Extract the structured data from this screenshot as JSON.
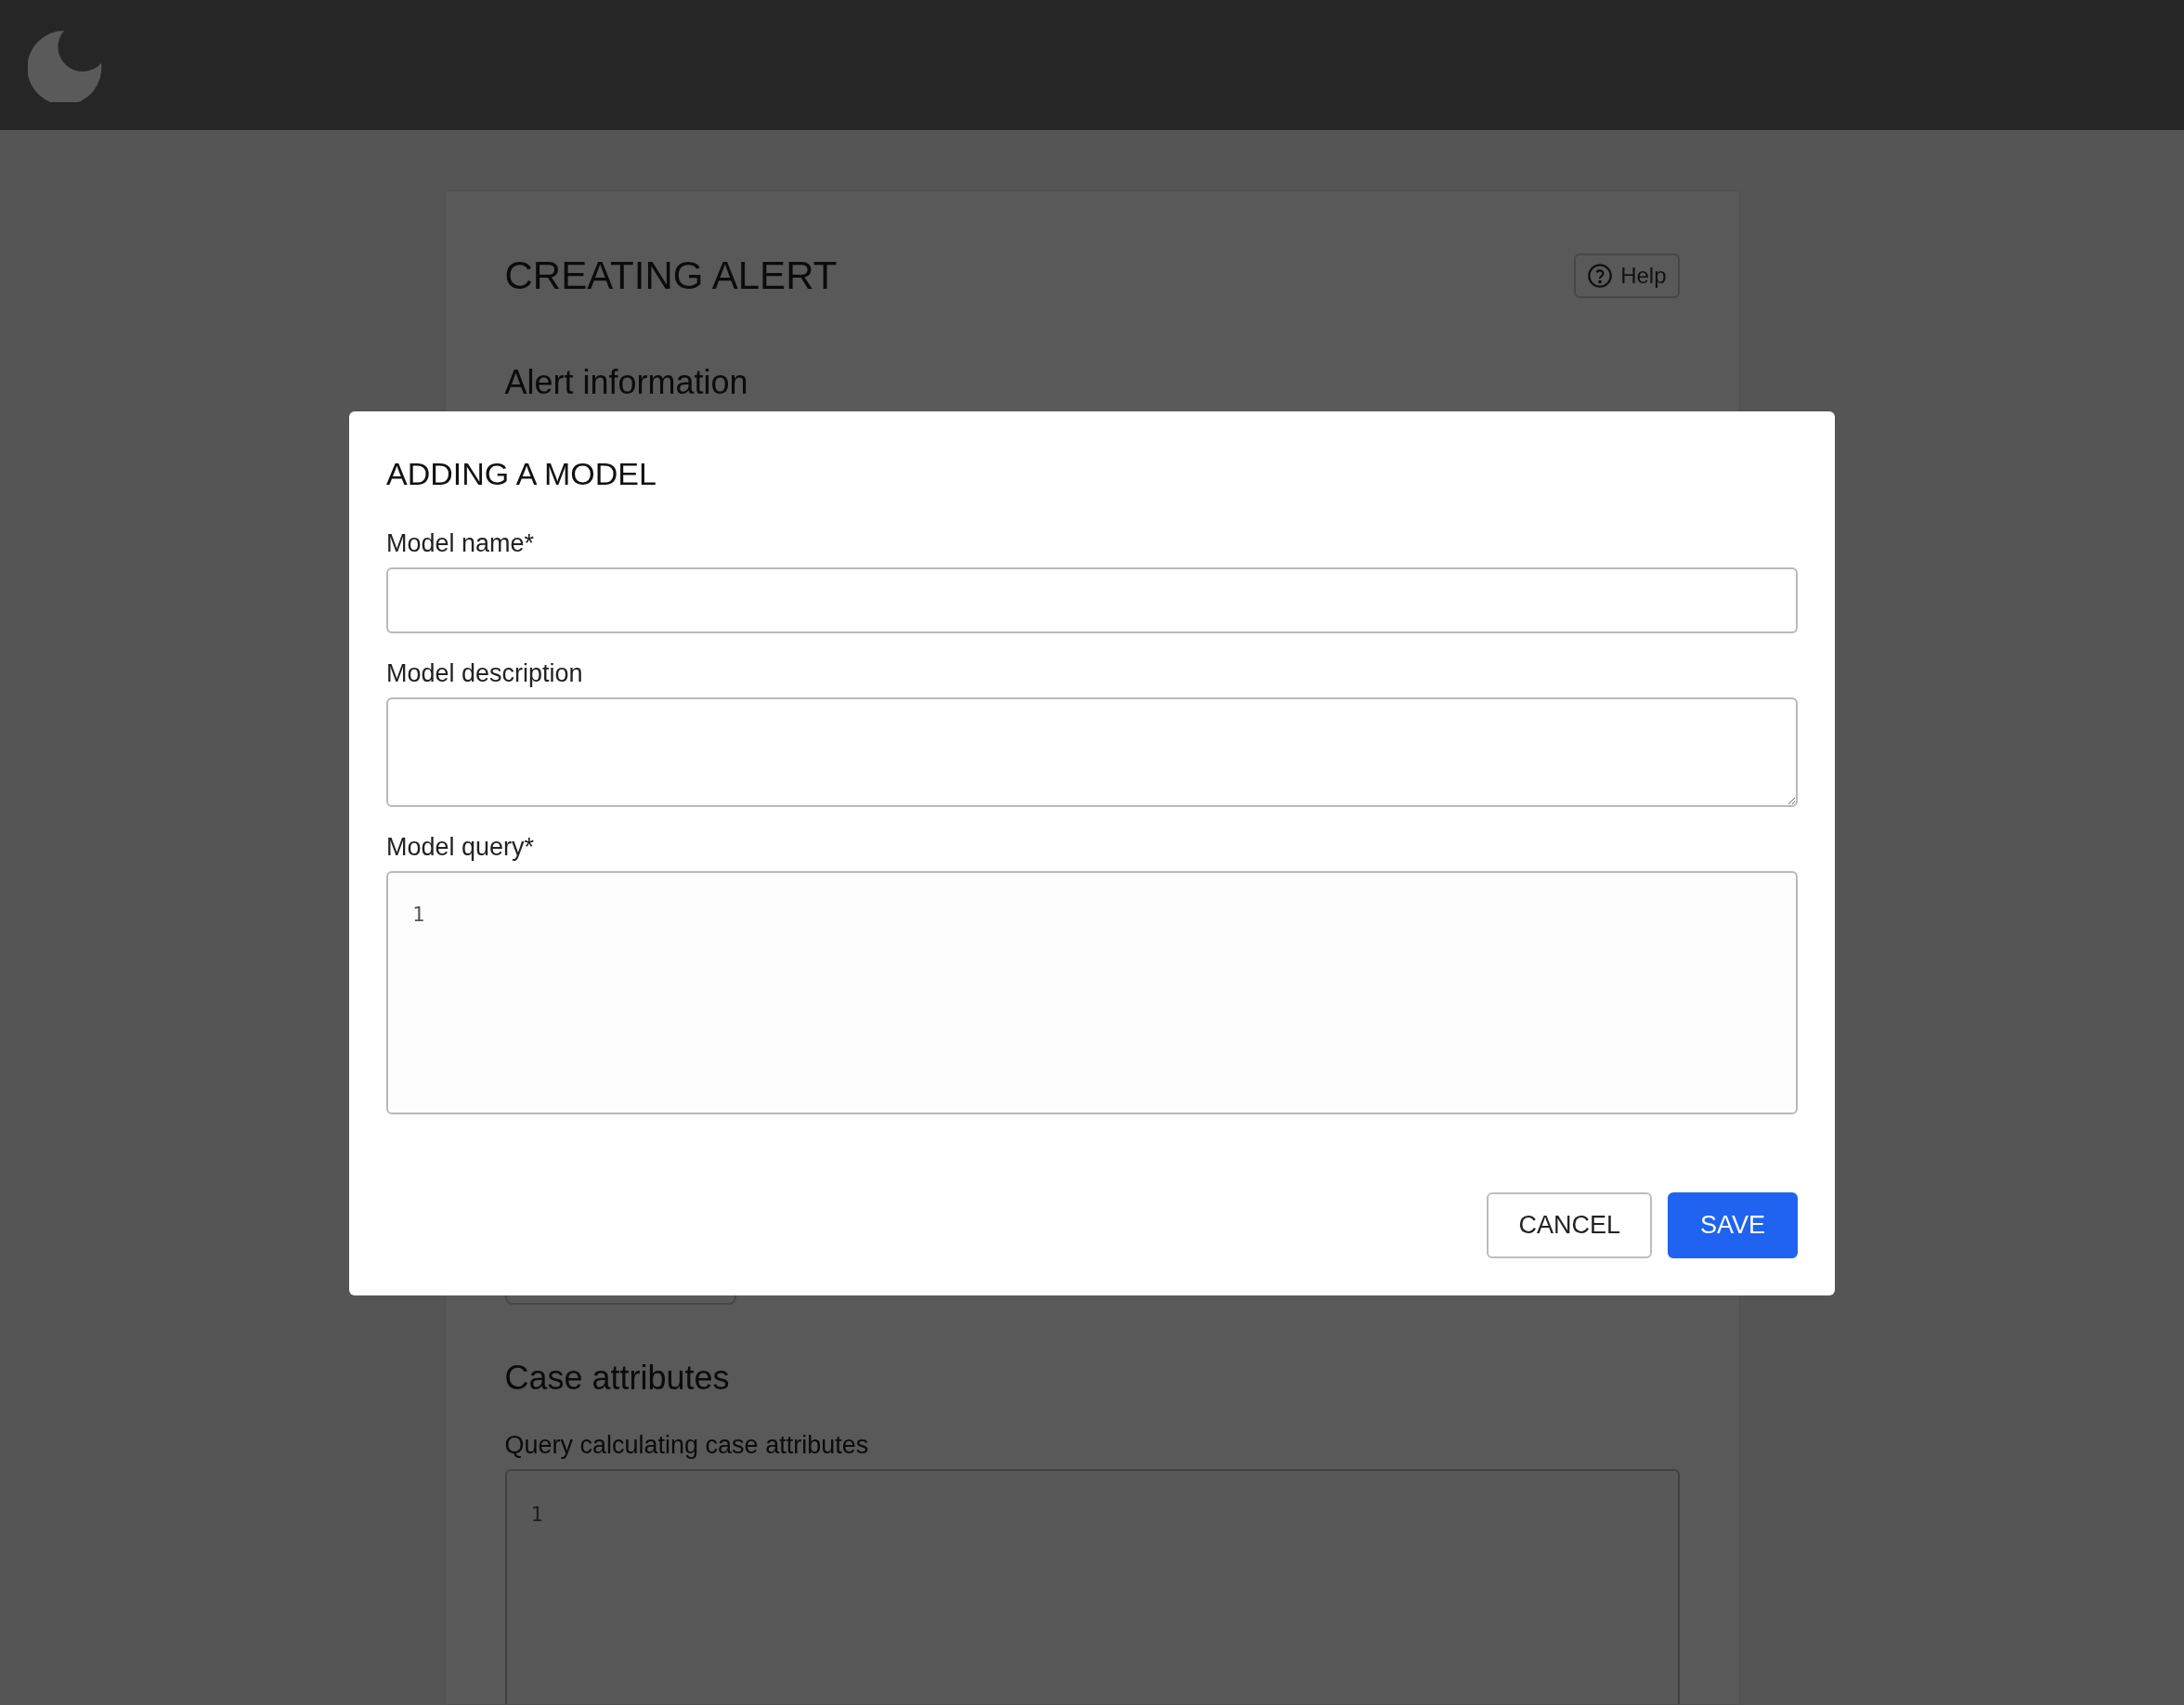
{
  "page": {
    "title": "CREATING ALERT",
    "help_button": "Help",
    "section_1": "Alert information",
    "section_2": "Case attributes",
    "query_label": "Query calculating case attributes",
    "query_line_numbers": [
      "1"
    ]
  },
  "dialog": {
    "title": "ADDING A MODEL",
    "fields": [
      {
        "kind": "input",
        "label": "Model name*"
      },
      {
        "kind": "textarea",
        "label": "Model description"
      },
      {
        "kind": "code",
        "label": "Model query*",
        "line_numbers": [
          "1"
        ]
      }
    ],
    "buttons": [
      {
        "label": "CANCEL",
        "kind": "secondary"
      },
      {
        "label": "SAVE",
        "kind": "primary"
      }
    ]
  }
}
